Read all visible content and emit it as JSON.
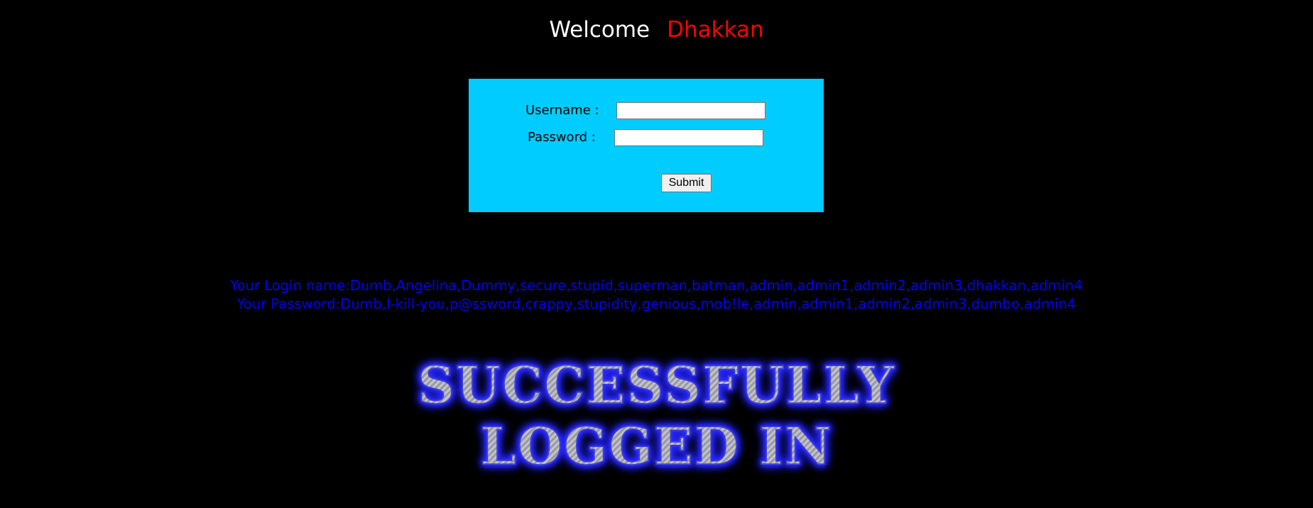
{
  "welcome": {
    "greeting": "Welcome",
    "username": "Dhakkan"
  },
  "login_form": {
    "username_label": "Username :",
    "password_label": "Password :",
    "username_value": "",
    "password_value": "",
    "submit_label": "Submit"
  },
  "result": {
    "login_names": "Your Login name:Dumb,Angelina,Dummy,secure,stupid,superman,batman,admin,admin1,admin2,admin3,dhakkan,admin4",
    "passwords": "Your Password:Dumb,I-kill-you,p@ssword,crappy,stupidity,genious,mob!le,admin,admin1,admin2,admin3,dumbo,admin4"
  },
  "success_banner": {
    "line1": "SUCCESSFULLY",
    "line2": "LOGGED IN"
  },
  "colors": {
    "background": "#000000",
    "form_background": "#00ccff",
    "name_color": "#ff0000",
    "credentials_color": "#0000ff"
  }
}
